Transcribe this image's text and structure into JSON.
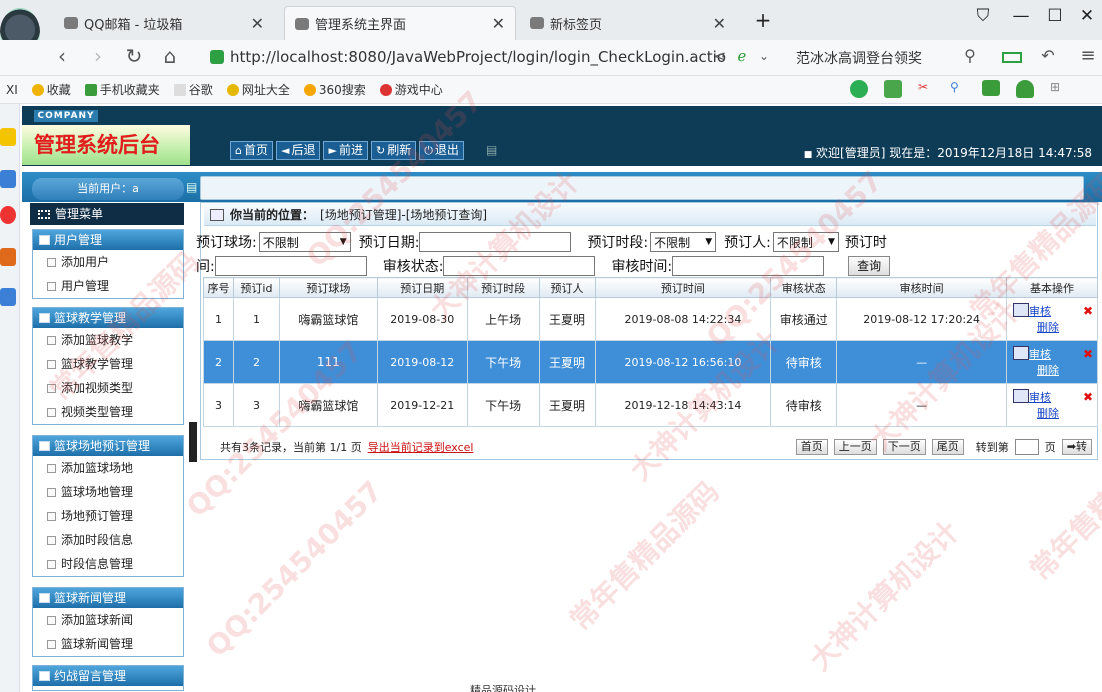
{
  "browser": {
    "tabs": [
      {
        "label": "QQ邮箱 - 垃圾箱",
        "active": false
      },
      {
        "label": "管理系统主界面",
        "active": true
      },
      {
        "label": "新标签页",
        "active": false
      }
    ],
    "new_tab": "+",
    "url": "http://localhost:8080/JavaWebProject/login/login_CheckLogin.actio",
    "search_text": "范冰冰高调登台领奖",
    "bookmarks": [
      "收藏",
      "手机收藏夹",
      "谷歌",
      "网址大全",
      "360搜索",
      "游戏中心"
    ],
    "left_cut": "XI"
  },
  "app": {
    "company": "COMPANY",
    "title": "管理系统后台",
    "nav": [
      {
        "icon": "home-icon",
        "glyph": "⌂",
        "label": "首页"
      },
      {
        "icon": "back-icon",
        "glyph": "◄",
        "label": "后退"
      },
      {
        "icon": "forward-icon",
        "glyph": "►",
        "label": "前进"
      },
      {
        "icon": "refresh-icon",
        "glyph": "↻",
        "label": "刷新"
      },
      {
        "icon": "power-icon",
        "glyph": "⏻",
        "label": "退出"
      }
    ],
    "welcome": "欢迎[管理员]  现在是：2019年12月18日 14:47:58",
    "current_user": "当前用户：a"
  },
  "sidebar": {
    "menu_title": "管理菜单",
    "groups": [
      {
        "title": "用户管理",
        "items": [
          "添加用户",
          "用户管理"
        ]
      },
      {
        "title": "篮球教学管理",
        "items": [
          "添加篮球教学",
          "篮球教学管理",
          "添加视频类型",
          "视频类型管理"
        ]
      },
      {
        "title": "篮球场地预订管理",
        "items": [
          "添加篮球场地",
          "篮球场地管理",
          "场地预订管理",
          "添加时段信息",
          "时段信息管理"
        ]
      },
      {
        "title": "篮球新闻管理",
        "items": [
          "添加篮球新闻",
          "篮球新闻管理"
        ]
      },
      {
        "title": "约战留言管理",
        "items": []
      }
    ]
  },
  "main": {
    "crumb_label": "你当前的位置：",
    "crumb_path": "[场地预订管理]-[场地预订查询]",
    "filters": {
      "court_label": "预订球场:",
      "court_value": "不限制",
      "date_label": "预订日期:",
      "slot_label": "预订时段:",
      "slot_value": "不限制",
      "person_label": "预订人:",
      "person_value": "不限制",
      "time_label_a": "预订时",
      "time_label_b": "间:",
      "status_label": "审核状态:",
      "audit_label": "审核时间:",
      "query_button": "查询"
    },
    "table": {
      "headers": [
        "序号",
        "预订id",
        "预订球场",
        "预订日期",
        "预订时段",
        "预订人",
        "预订时间",
        "审核状态",
        "审核时间",
        "基本操作"
      ],
      "rows": [
        [
          "1",
          "1",
          "嗨霸篮球馆",
          "2019-08-30",
          "上午场",
          "王夏明",
          "2019-08-08 14:22:34",
          "审核通过",
          "2019-08-12 17:20:24"
        ],
        [
          "2",
          "2",
          "111",
          "2019-08-12",
          "下午场",
          "王夏明",
          "2019-08-12 16:56:10",
          "待审核",
          "—"
        ],
        [
          "3",
          "3",
          "嗨霸篮球馆",
          "2019-12-21",
          "下午场",
          "王夏明",
          "2019-12-18 14:43:14",
          "待审核",
          "—"
        ]
      ],
      "op_review": "审核",
      "op_delete": "删除"
    },
    "pager": {
      "summary": "共有3条记录，当前第 1/1 页",
      "export": "导出当前记录到excel",
      "first": "首页",
      "prev": "上一页",
      "next": "下一页",
      "last": "尾页",
      "goto_label": "转到第",
      "page_unit": "页",
      "go": "➡转"
    }
  },
  "watermark": [
    "常年售精品源码",
    "QQ:254540457",
    "大神计算机设计"
  ],
  "bottom_text": "精品源码设计"
}
